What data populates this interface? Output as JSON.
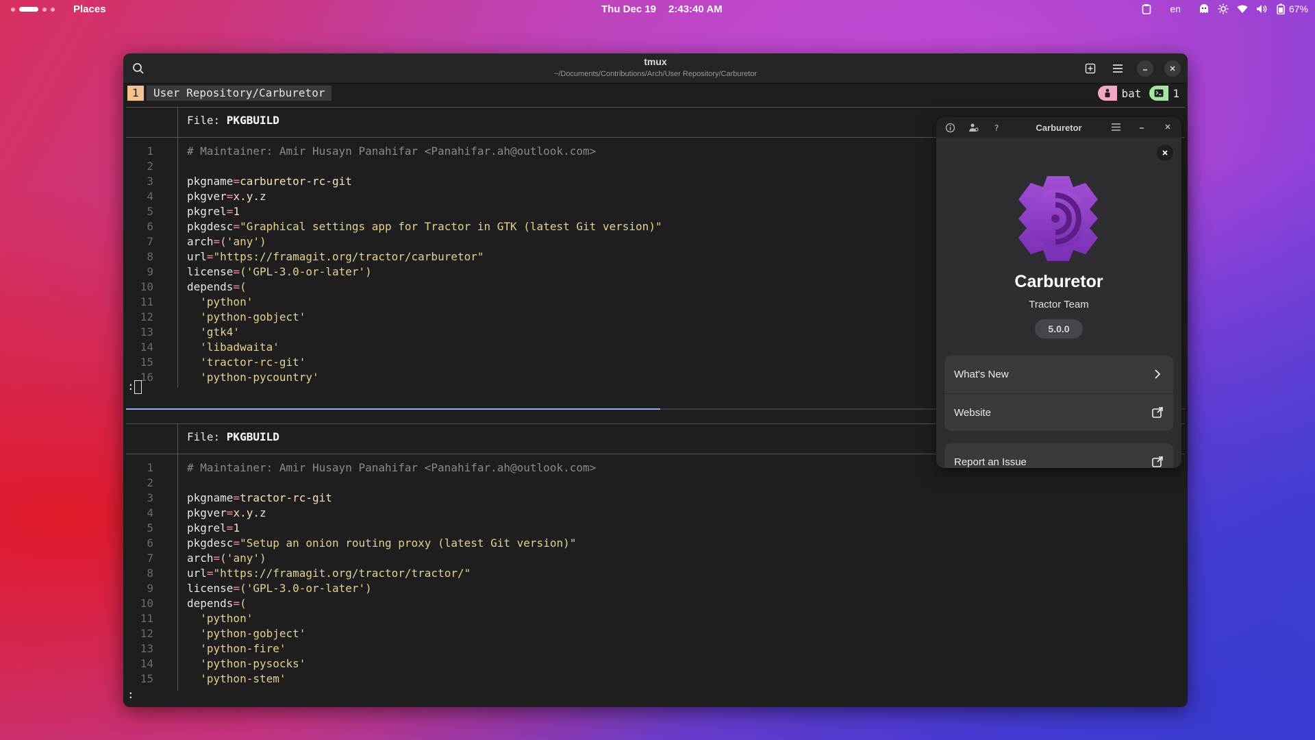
{
  "topbar": {
    "places": "Places",
    "date": "Thu Dec 19",
    "time": "2:43:40 AM",
    "lang": "en",
    "battery": "67%"
  },
  "terminal": {
    "title": "tmux",
    "subtitle": "~/Documents/Contributions/Arch/User Repository/Carburetor",
    "status": {
      "window_number": "1",
      "window_name": "User Repository/Carburetor",
      "program": "bat",
      "pane_count": "1"
    },
    "pane_top": {
      "file_label": "File: ",
      "file_name": "PKGBUILD",
      "prompt": ":",
      "lines": [
        {
          "n": "1",
          "key": "",
          "op": "",
          "val": "",
          "comment": "# Maintainer: Amir Husayn Panahifar <Panahifar.ah@outlook.com>"
        },
        {
          "n": "2",
          "key": "",
          "op": "",
          "val": "",
          "comment": ""
        },
        {
          "n": "3",
          "key": "pkgname",
          "op": "=",
          "val": "carburetor-rc-git",
          "comment": ""
        },
        {
          "n": "4",
          "key": "pkgver",
          "op": "=",
          "val": "x.y.z",
          "comment": ""
        },
        {
          "n": "5",
          "key": "pkgrel",
          "op": "=",
          "val": "1",
          "comment": ""
        },
        {
          "n": "6",
          "key": "pkgdesc",
          "op": "=",
          "val": "\"Graphical settings app for Tractor in GTK (latest Git version)\"",
          "comment": ""
        },
        {
          "n": "7",
          "key": "arch",
          "op": "=",
          "val": "('any')",
          "comment": ""
        },
        {
          "n": "8",
          "key": "url",
          "op": "=",
          "val": "\"https://framagit.org/tractor/carburetor\"",
          "comment": ""
        },
        {
          "n": "9",
          "key": "license",
          "op": "=",
          "val": "('GPL-3.0-or-later')",
          "comment": ""
        },
        {
          "n": "10",
          "key": "depends",
          "op": "=",
          "val": "(",
          "comment": ""
        },
        {
          "n": "11",
          "key": "  ",
          "op": "",
          "val": "'python'",
          "comment": ""
        },
        {
          "n": "12",
          "key": "  ",
          "op": "",
          "val": "'python-gobject'",
          "comment": ""
        },
        {
          "n": "13",
          "key": "  ",
          "op": "",
          "val": "'gtk4'",
          "comment": ""
        },
        {
          "n": "14",
          "key": "  ",
          "op": "",
          "val": "'libadwaita'",
          "comment": ""
        },
        {
          "n": "15",
          "key": "  ",
          "op": "",
          "val": "'tractor-rc-git'",
          "comment": ""
        },
        {
          "n": "16",
          "key": "  ",
          "op": "",
          "val": "'python-pycountry'",
          "comment": ""
        }
      ]
    },
    "pane_bottom": {
      "file_label": "File: ",
      "file_name": "PKGBUILD",
      "prompt": ":",
      "lines": [
        {
          "n": "1",
          "key": "",
          "op": "",
          "val": "",
          "comment": "# Maintainer: Amir Husayn Panahifar <Panahifar.ah@outlook.com>"
        },
        {
          "n": "2",
          "key": "",
          "op": "",
          "val": "",
          "comment": ""
        },
        {
          "n": "3",
          "key": "pkgname",
          "op": "=",
          "val": "tractor-rc-git",
          "comment": ""
        },
        {
          "n": "4",
          "key": "pkgver",
          "op": "=",
          "val": "x.y.z",
          "comment": ""
        },
        {
          "n": "5",
          "key": "pkgrel",
          "op": "=",
          "val": "1",
          "comment": ""
        },
        {
          "n": "6",
          "key": "pkgdesc",
          "op": "=",
          "val": "\"Setup an onion routing proxy (latest Git version)\"",
          "comment": ""
        },
        {
          "n": "7",
          "key": "arch",
          "op": "=",
          "val": "('any')",
          "comment": ""
        },
        {
          "n": "8",
          "key": "url",
          "op": "=",
          "val": "\"https://framagit.org/tractor/tractor/\"",
          "comment": ""
        },
        {
          "n": "9",
          "key": "license",
          "op": "=",
          "val": "('GPL-3.0-or-later')",
          "comment": ""
        },
        {
          "n": "10",
          "key": "depends",
          "op": "=",
          "val": "(",
          "comment": ""
        },
        {
          "n": "11",
          "key": "  ",
          "op": "",
          "val": "'python'",
          "comment": ""
        },
        {
          "n": "12",
          "key": "  ",
          "op": "",
          "val": "'python-gobject'",
          "comment": ""
        },
        {
          "n": "13",
          "key": "  ",
          "op": "",
          "val": "'python-fire'",
          "comment": ""
        },
        {
          "n": "14",
          "key": "  ",
          "op": "",
          "val": "'python-pysocks'",
          "comment": ""
        },
        {
          "n": "15",
          "key": "  ",
          "op": "",
          "val": "'python-stem'",
          "comment": ""
        }
      ]
    }
  },
  "about": {
    "window_title": "Carburetor",
    "app_name": "Carburetor",
    "developer": "Tractor Team",
    "version": "5.0.0",
    "rows": [
      {
        "label": "What's New",
        "icon": "chevron-right-icon"
      },
      {
        "label": "Website",
        "icon": "external-link-icon"
      },
      {
        "label": "Report an Issue",
        "icon": "external-link-icon"
      }
    ],
    "accent": "#8e3fc7"
  }
}
